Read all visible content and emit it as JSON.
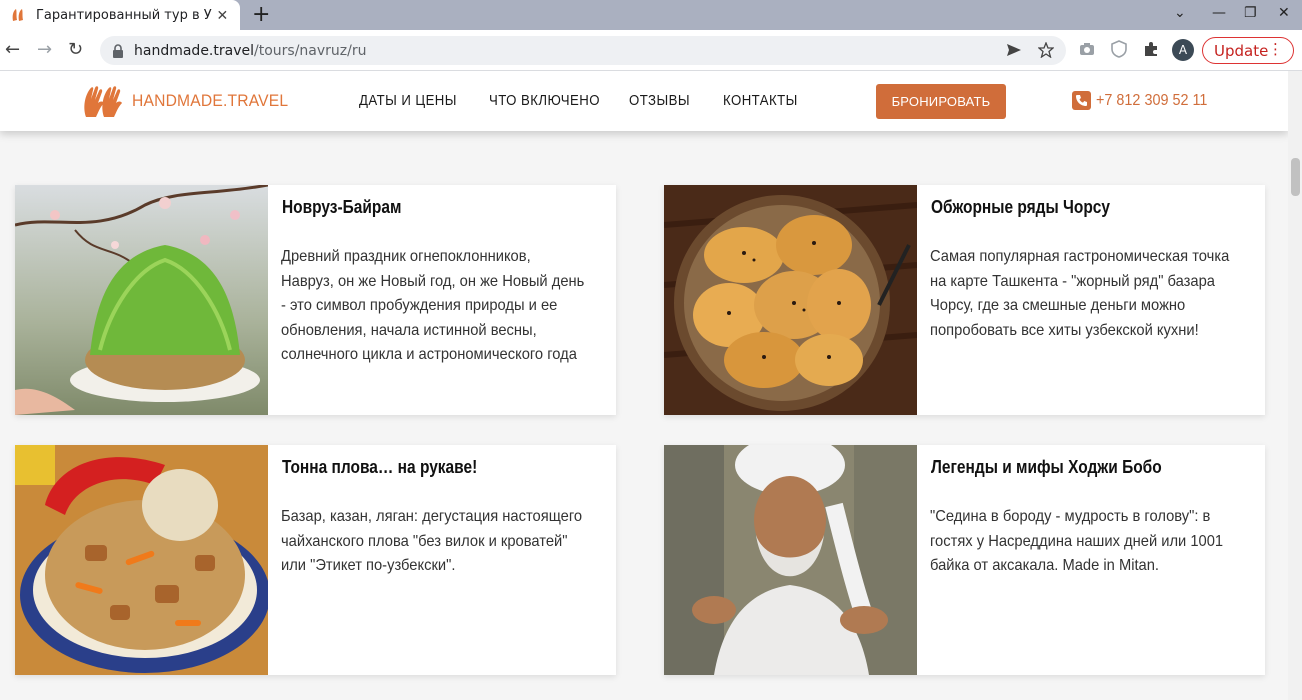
{
  "browser": {
    "tab_title": "Гарантированный тур в У",
    "tab_close": "✕",
    "new_tab": "+",
    "url_host": "handmade.travel",
    "url_path": "/tours/navruz/ru",
    "avatar_initial": "A",
    "update_label": "Update",
    "update_menu": "⋮",
    "window_controls": [
      "⌄",
      "—",
      "❐",
      "✕"
    ],
    "nav": {
      "back": "←",
      "forward": "→",
      "reload": "↻"
    }
  },
  "site": {
    "logo_text": "HANDMADE.TRAVEL",
    "nav": [
      "ДАТЫ И ЦЕНЫ",
      "ЧТО ВКЛЮЧЕНО",
      "ОТЗЫВЫ",
      "КОНТАКТЫ"
    ],
    "book_label": "БРОНИРОВАТЬ",
    "phone": "+7 812 309 52 11",
    "accent": "#d06d3a"
  },
  "cards": [
    {
      "title": "Новруз-Байрам",
      "text": "Древний праздник огнепоклонников, Навруз, он же Новый год, он же Новый день - это символ пробуждения природы и ее обновления, начала истинной весны, солнечного цикла и астрономического года",
      "image": "sprouted-wheat-sumalak-photo"
    },
    {
      "title": "Обжорные ряды Чорсу",
      "text": "Самая популярная гастрономическая точка на карте Ташкента - \"жорный ряд\" базара Чорсу, где за смешные деньги можно попробовать все хиты узбекской кухни!",
      "image": "samsa-pastries-photo"
    },
    {
      "title": "Тонна плова… на рукаве!",
      "text": "Базар, казан, ляган: дегустация настоящего чайханского плова \"без вилок и кроватей\" или \"Этикет по-узбекски\".",
      "image": "plov-dish-photo"
    },
    {
      "title": "Легенды и мифы Ходжи Бобо",
      "text": "\"Седина в бороду - мудрость в голову\": в гостях у Насреддина наших дней или 1001 байка от аксакала. Made in Mitan.",
      "image": "old-man-turban-photo"
    }
  ]
}
